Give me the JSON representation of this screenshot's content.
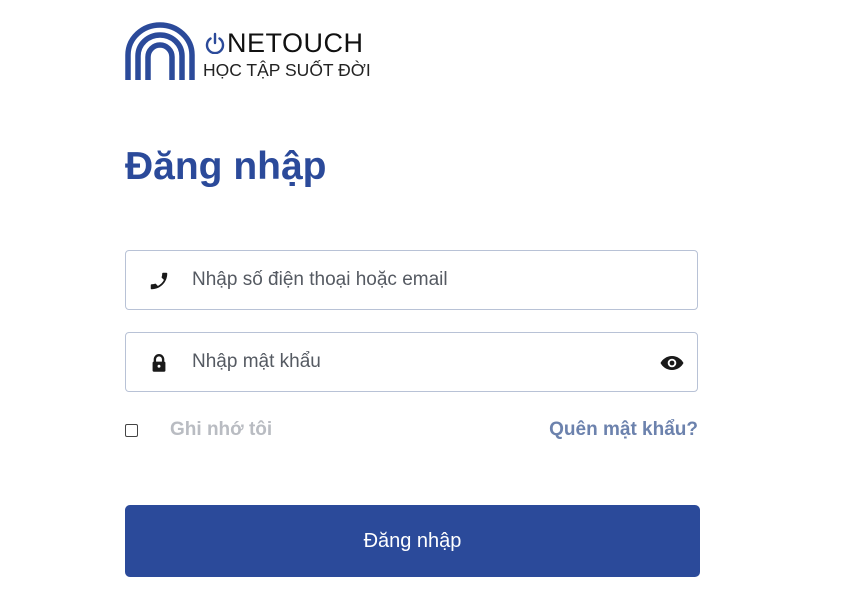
{
  "brand": {
    "name_suffix": "NETOUCH",
    "slogan": "HỌC TẬP SUỐT ĐỜI",
    "color": "#2b4a9a"
  },
  "login": {
    "title": "Đăng nhập",
    "phone_field": {
      "placeholder": "Nhập số điện thoại hoặc email",
      "value": "",
      "icon": "phone-icon"
    },
    "password_field": {
      "placeholder": "Nhập mật khẩu",
      "value": "",
      "icon": "lock-icon",
      "toggle_icon": "eye-icon"
    },
    "remember_label": "Ghi nhớ tôi",
    "remember_checked": false,
    "forgot_link": "Quên mật khẩu?",
    "submit_label": "Đăng nhập"
  },
  "colors": {
    "primary": "#2b4a9a",
    "link": "#6c82ad",
    "muted": "#b9bcc2",
    "field_border": "#b8c2d6"
  }
}
